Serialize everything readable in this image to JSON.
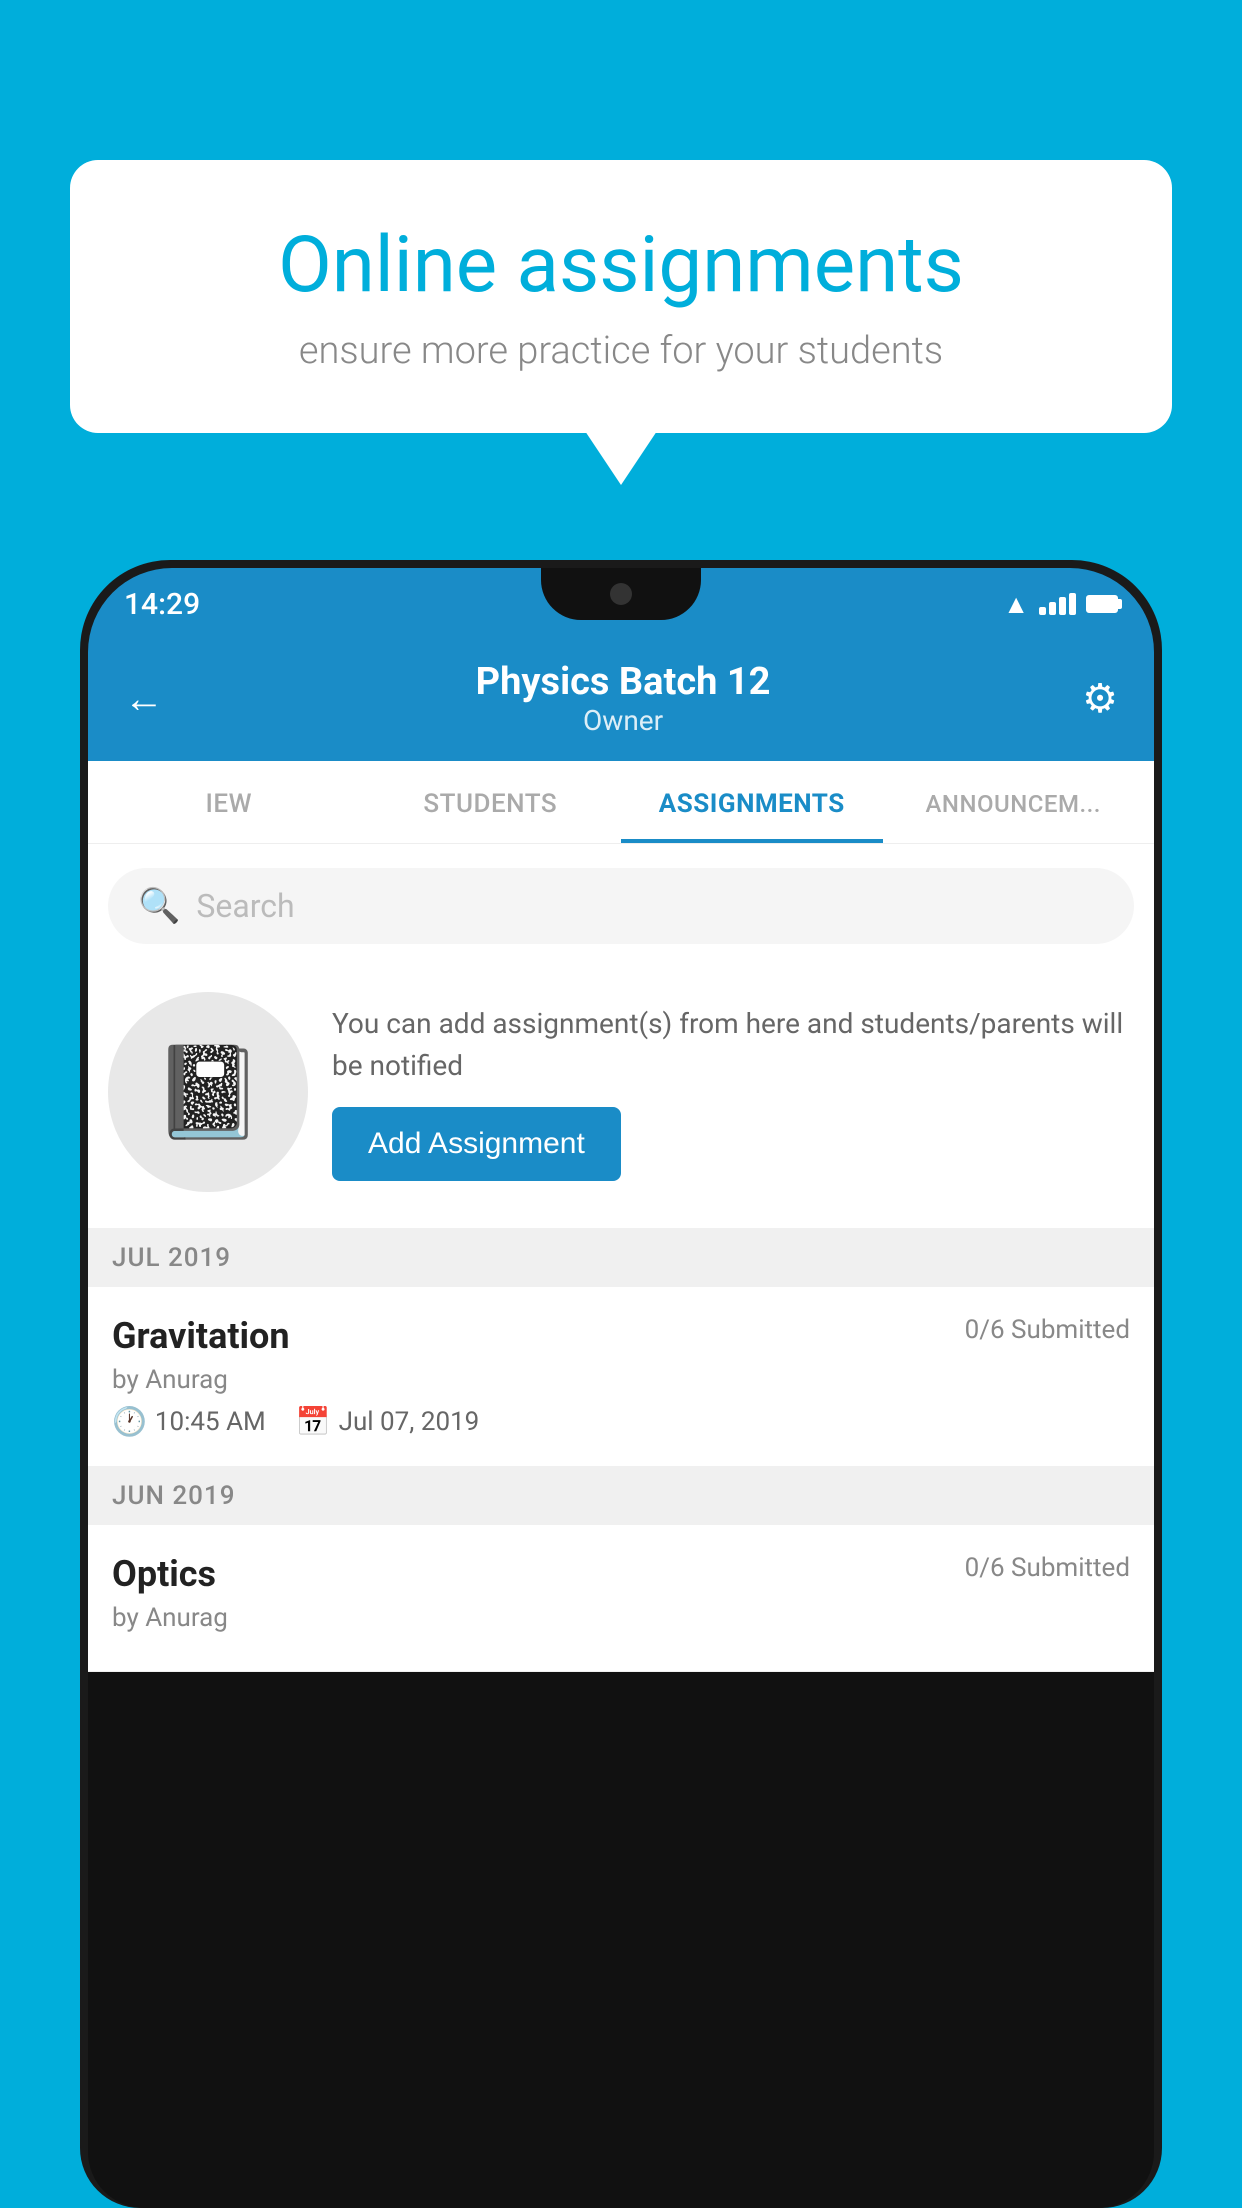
{
  "background_color": "#00AEDB",
  "speech_bubble": {
    "title": "Online assignments",
    "subtitle": "ensure more practice for your students"
  },
  "phone": {
    "status_bar": {
      "time": "14:29"
    },
    "header": {
      "title": "Physics Batch 12",
      "subtitle": "Owner",
      "back_label": "←",
      "gear_label": "⚙"
    },
    "tabs": [
      {
        "label": "IEW",
        "active": false
      },
      {
        "label": "STUDENTS",
        "active": false
      },
      {
        "label": "ASSIGNMENTS",
        "active": true
      },
      {
        "label": "ANNOUNCEM...",
        "active": false
      }
    ],
    "search": {
      "placeholder": "Search"
    },
    "info_card": {
      "description": "You can add assignment(s) from here and students/parents will be notified",
      "button_label": "Add Assignment"
    },
    "sections": [
      {
        "month": "JUL 2019",
        "assignments": [
          {
            "name": "Gravitation",
            "submitted": "0/6 Submitted",
            "author": "by Anurag",
            "time": "10:45 AM",
            "date": "Jul 07, 2019"
          }
        ]
      },
      {
        "month": "JUN 2019",
        "assignments": [
          {
            "name": "Optics",
            "submitted": "0/6 Submitted",
            "author": "by Anurag",
            "time": "",
            "date": ""
          }
        ]
      }
    ]
  }
}
